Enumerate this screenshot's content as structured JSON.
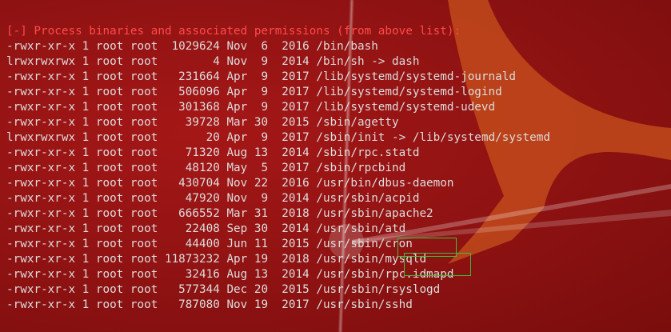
{
  "terminal": {
    "header": "[-] Process binaries and associated permissions (from above list):",
    "lines": [
      "-rwxr-xr-x 1 root root  1029624 Nov  6  2016 /bin/bash",
      "lrwxrwxrwx 1 root root        4 Nov  9  2014 /bin/sh -> dash",
      "-rwxr-xr-x 1 root root   231664 Apr  9  2017 /lib/systemd/systemd-journald",
      "-rwxr-xr-x 1 root root   506096 Apr  9  2017 /lib/systemd/systemd-logind",
      "-rwxr-xr-x 1 root root   301368 Apr  9  2017 /lib/systemd/systemd-udevd",
      "-rwxr-xr-x 1 root root    39728 Mar 30  2015 /sbin/agetty",
      "lrwxrwxrwx 1 root root       20 Apr  9  2017 /sbin/init -> /lib/systemd/systemd",
      "-rwxr-xr-x 1 root root    71320 Aug 13  2014 /sbin/rpc.statd",
      "-rwxr-xr-x 1 root root    48120 May  5  2017 /sbin/rpcbind",
      "-rwxr-xr-x 1 root root   430704 Nov 22  2016 /usr/bin/dbus-daemon",
      "-rwxr-xr-x 1 root root    47920 Nov  9  2014 /usr/sbin/acpid",
      "-rwxr-xr-x 1 root root   666552 Mar 31  2018 /usr/sbin/apache2",
      "-rwxr-xr-x 1 root root    22408 Sep 30  2014 /usr/sbin/atd",
      "-rwxr-xr-x 1 root root    44400 Jun 11  2015 /usr/sbin/cron",
      "-rwxr-xr-x 1 root root 11873232 Apr 19  2018 /usr/sbin/mysqld",
      "-rwxr-xr-x 1 root root    32416 Aug 13  2014 /usr/sbin/rpc.idmapd",
      "-rwxr-xr-x 1 root root   577344 Dec 20  2015 /usr/sbin/rsyslogd",
      "-rwxr-xr-x 1 root root   787080 Nov 19  2017 /usr/sbin/sshd"
    ]
  },
  "colors": {
    "background": "#8e1212",
    "text": "#dcdcdc",
    "header": "#ff4a4a",
    "highlight": "#3cbf3c",
    "logo_accent": "#d9621c"
  }
}
